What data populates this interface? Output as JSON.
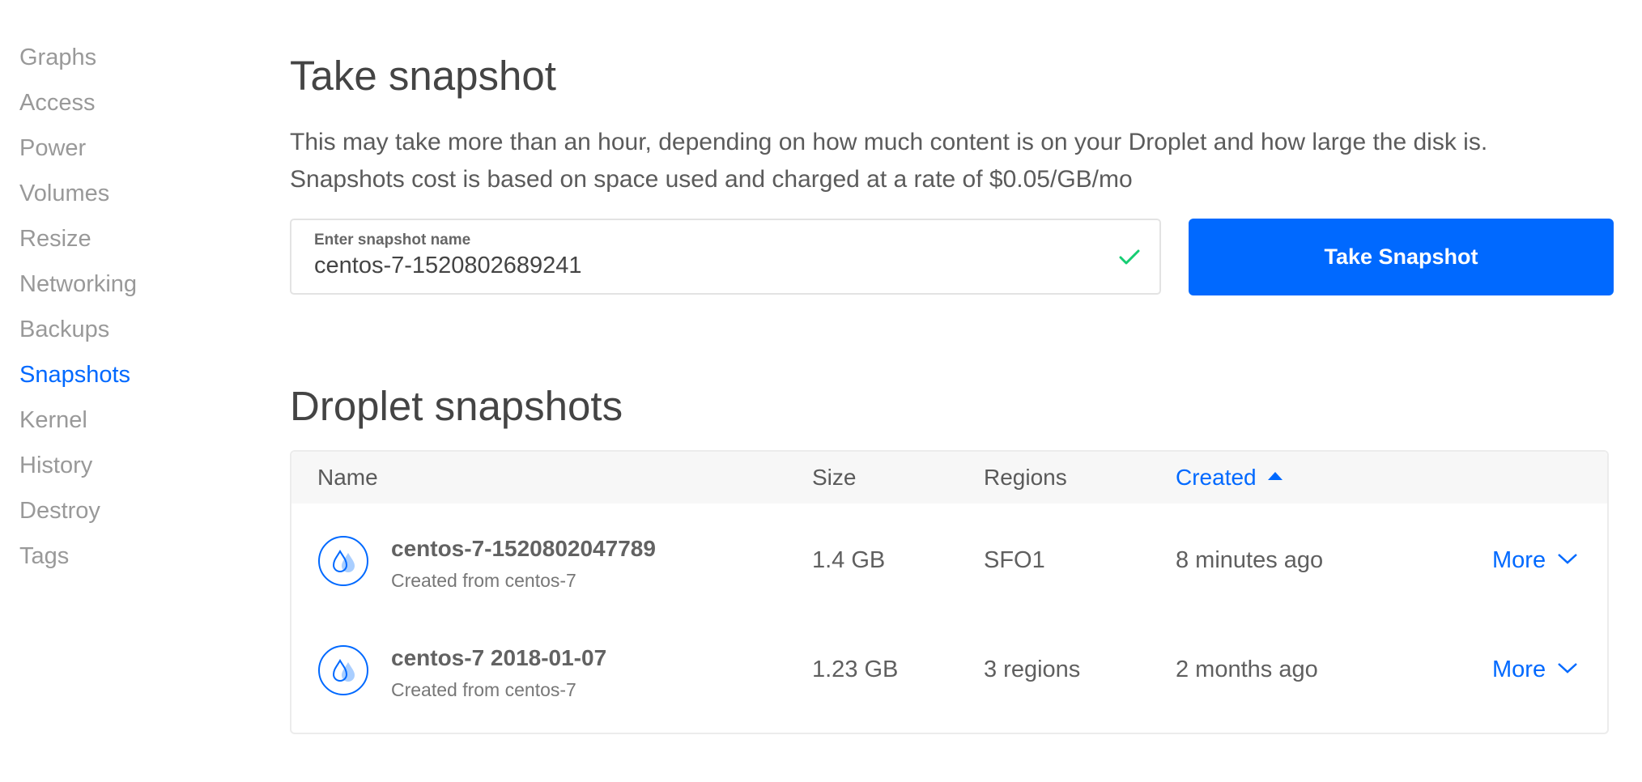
{
  "sidebar": {
    "items": [
      {
        "label": "Graphs",
        "active": false
      },
      {
        "label": "Access",
        "active": false
      },
      {
        "label": "Power",
        "active": false
      },
      {
        "label": "Volumes",
        "active": false
      },
      {
        "label": "Resize",
        "active": false
      },
      {
        "label": "Networking",
        "active": false
      },
      {
        "label": "Backups",
        "active": false
      },
      {
        "label": "Snapshots",
        "active": true
      },
      {
        "label": "Kernel",
        "active": false
      },
      {
        "label": "History",
        "active": false
      },
      {
        "label": "Destroy",
        "active": false
      },
      {
        "label": "Tags",
        "active": false
      }
    ]
  },
  "take_snapshot": {
    "title": "Take snapshot",
    "description_line1": "This may take more than an hour, depending on how much content is on your Droplet and how large the disk is.",
    "description_line2": "Snapshots cost is based on space used and charged at a rate of $0.05/GB/mo",
    "input_label": "Enter snapshot name",
    "input_value": "centos-7-1520802689241",
    "input_valid_icon": "check-icon",
    "button_label": "Take Snapshot"
  },
  "droplet_snapshots": {
    "title": "Droplet snapshots",
    "columns": {
      "name": "Name",
      "size": "Size",
      "regions": "Regions",
      "created": "Created",
      "sort_icon": "caret-up-icon"
    },
    "rows": [
      {
        "name": "centos-7-1520802047789",
        "subtitle": "Created from centos-7",
        "size": "1.4 GB",
        "regions": "SFO1",
        "created": "8 minutes ago",
        "action": "More"
      },
      {
        "name": "centos-7 2018-01-07",
        "subtitle": "Created from centos-7",
        "size": "1.23 GB",
        "regions": "3 regions",
        "created": "2 months ago",
        "action": "More"
      }
    ]
  },
  "colors": {
    "accent": "#0069ff",
    "success": "#15cd72",
    "muted_text": "#999999"
  }
}
